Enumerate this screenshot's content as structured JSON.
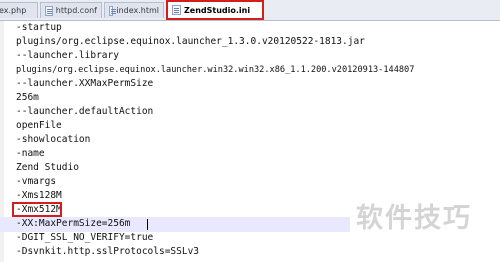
{
  "tabs": [
    {
      "label": "ex.php"
    },
    {
      "label": "httpd.conf"
    },
    {
      "label": "index.html"
    },
    {
      "label": "ZendStudio.ini"
    }
  ],
  "editor": {
    "lines": [
      "-startup",
      "plugins/org.eclipse.equinox.launcher_1.3.0.v20120522-1813.jar",
      "--launcher.library",
      "plugins/org.eclipse.equinox.launcher.win32.win32.x86_1.1.200.v20120913-144807",
      "--launcher.XXMaxPermSize",
      "256m",
      "--launcher.defaultAction",
      "openFile",
      "-showlocation",
      "-name",
      "Zend Studio",
      "-vmargs",
      "-Xms128M",
      "-Xmx512M",
      "-XX:MaxPermSize=256m",
      "-DGIT_SSL_NO_VERIFY=true",
      "-Dsvnkit.http.sslProtocols=SSLv3"
    ]
  },
  "watermark": "软件技巧"
}
